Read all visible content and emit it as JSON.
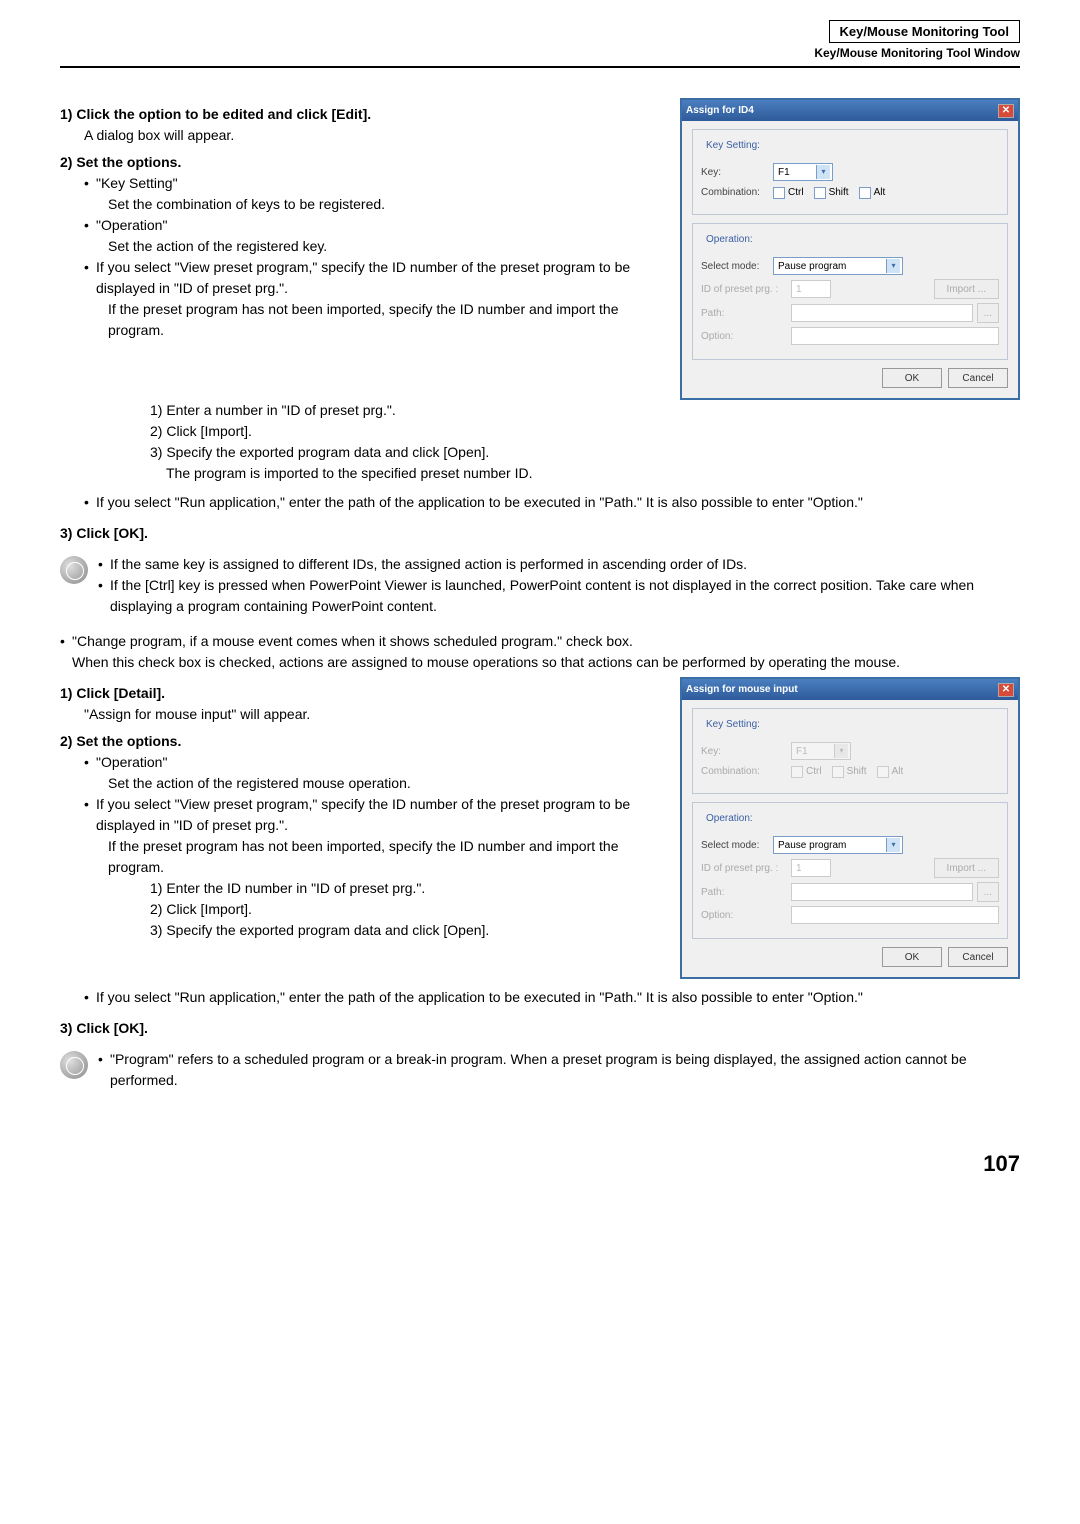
{
  "header": {
    "title": "Key/Mouse Monitoring Tool",
    "subtitle": "Key/Mouse Monitoring Tool Window"
  },
  "page_number": "107",
  "s1": {
    "step1": "1) Click the option to be edited and click [Edit].",
    "step1_sub": "A dialog box will appear.",
    "step2": "2) Set the options.",
    "s2_b1": "\"Key Setting\"",
    "s2_b1_sub": "Set the combination of keys to be registered.",
    "s2_b2": "\"Operation\"",
    "s2_b2_sub": "Set the action of the registered key.",
    "s2_b3a": "If you select \"View preset program,\" specify the ID number of the preset program to be displayed in \"ID of preset prg.\".",
    "s2_b3b": "If the preset program has not been imported, specify the ID number and import the program.",
    "s2_n1": "1)  Enter a number in \"ID of preset prg.\".",
    "s2_n2": "2)  Click [Import].",
    "s2_n3": "3)  Specify the exported program data and click [Open].",
    "s2_n3_sub": "The program is imported to the specified preset number ID.",
    "s2_b4": "If you select \"Run application,\" enter the path of the application to be executed in \"Path.\" It is also possible to enter \"Option.\"",
    "step3": "3) Click [OK].",
    "note1": "If the same key is assigned to different IDs, the assigned action is performed in ascending order of IDs.",
    "note2": "If the [Ctrl] key is pressed when PowerPoint Viewer is launched, PowerPoint content is not displayed in the correct position. Take care when displaying a program containing PowerPoint content."
  },
  "mid": {
    "b1": "\"Change program, if a mouse event comes when it shows scheduled program.\" check box.",
    "b1_sub": "When this check box is checked, actions are assigned to mouse operations so that actions can be performed by operating the mouse."
  },
  "s2": {
    "step1": "1) Click [Detail].",
    "step1_sub": "\"Assign for mouse input\" will appear.",
    "step2": "2) Set the options.",
    "b1": "\"Operation\"",
    "b1_sub": "Set the action of the registered mouse operation.",
    "b2a": "If you select \"View preset program,\" specify the ID number of the preset program to be displayed in \"ID of preset prg.\".",
    "b2b": "If the preset program has not been imported, specify the ID number and import the program.",
    "n1": "1)  Enter the ID number in \"ID of preset prg.\".",
    "n2": "2)  Click [Import].",
    "n3": "3)  Specify the exported program data and click [Open].",
    "b3": "If you select \"Run application,\" enter the path of the application to be executed in \"Path.\" It is also possible to enter \"Option.\"",
    "step3": "3) Click [OK].",
    "note1": "\"Program\" refers to a scheduled program or a break-in program. When a preset program is being displayed, the assigned action cannot be performed."
  },
  "dialog1": {
    "title": "Assign for ID4",
    "key_setting": "Key Setting:",
    "key_label": "Key:",
    "key_value": "F1",
    "comb_label": "Combination:",
    "ctrl": "Ctrl",
    "shift": "Shift",
    "alt": "Alt",
    "operation": "Operation:",
    "selmode_label": "Select mode:",
    "selmode_value": "Pause program",
    "idpreset": "ID of preset prg. :",
    "idpreset_val": "1",
    "import": "Import ...",
    "path": "Path:",
    "browse": "...",
    "option": "Option:",
    "ok": "OK",
    "cancel": "Cancel"
  },
  "dialog2": {
    "title": "Assign for mouse input",
    "key_setting": "Key Setting:",
    "key_label": "Key:",
    "key_value": "F1",
    "comb_label": "Combination:",
    "ctrl": "Ctrl",
    "shift": "Shift",
    "alt": "Alt",
    "operation": "Operation:",
    "selmode_label": "Select mode:",
    "selmode_value": "Pause program",
    "idpreset": "ID of preset prg. :",
    "idpreset_val": "1",
    "import": "Import ...",
    "path": "Path:",
    "browse": "...",
    "option": "Option:",
    "ok": "OK",
    "cancel": "Cancel"
  }
}
